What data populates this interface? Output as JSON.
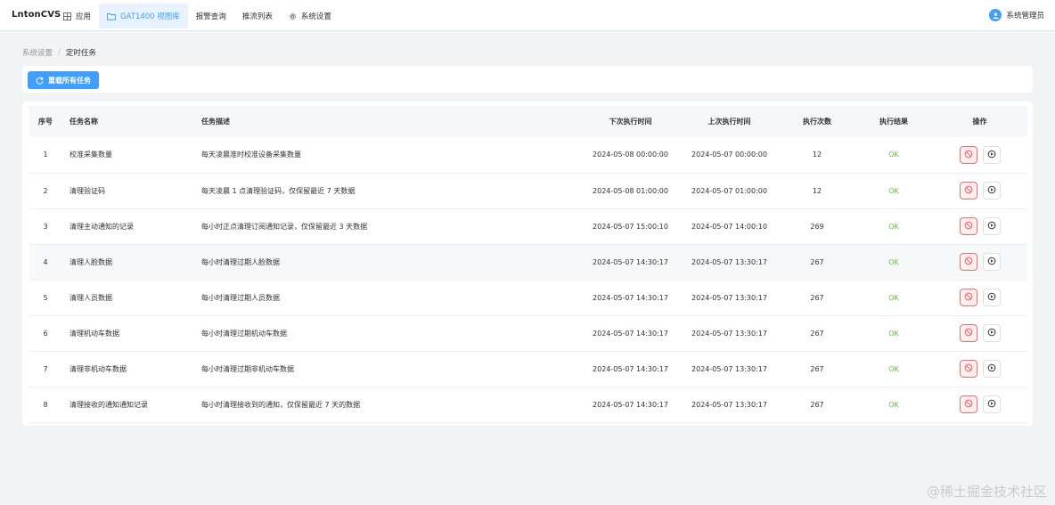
{
  "app": {
    "brand": "LntonCVS"
  },
  "nav": {
    "items": [
      {
        "label": "应用",
        "icon": "grid-icon"
      },
      {
        "label": "GAT1400 视图库",
        "icon": "folder-icon",
        "active": true
      },
      {
        "label": "报警查询"
      },
      {
        "label": "推流列表"
      },
      {
        "label": "系统设置",
        "icon": "gear-icon"
      }
    ]
  },
  "user": {
    "name": "系统管理员",
    "icon": "user-avatar-icon"
  },
  "breadcrumb": {
    "parent": "系统设置",
    "separator": "/",
    "current": "定时任务"
  },
  "toolbar": {
    "reload_label": "重载所有任务",
    "reload_icon": "refresh-icon"
  },
  "table": {
    "headers": {
      "index": "序号",
      "name": "任务名称",
      "description": "任务描述",
      "next_run": "下次执行时间",
      "last_run": "上次执行时间",
      "count": "执行次数",
      "result": "执行结果",
      "actions": "操作"
    },
    "rows": [
      {
        "index": "1",
        "name": "校准采集数量",
        "description": "每天凌晨准时校准设备采集数量",
        "next_run": "2024-05-08 00:00:00",
        "last_run": "2024-05-07 00:00:00",
        "count": "12",
        "result": "OK"
      },
      {
        "index": "2",
        "name": "清理验证码",
        "description": "每天凌晨 1 点清理验证码，仅保留最近 7 天数据",
        "next_run": "2024-05-08 01:00:00",
        "last_run": "2024-05-07 01:00:00",
        "count": "12",
        "result": "OK"
      },
      {
        "index": "3",
        "name": "清理主动通知的记录",
        "description": "每小时正点清理订阅通知记录，仅保留最近 3 天数据",
        "next_run": "2024-05-07 15:00:10",
        "last_run": "2024-05-07 14:00:10",
        "count": "269",
        "result": "OK"
      },
      {
        "index": "4",
        "name": "清理人脸数据",
        "description": "每小时清理过期人脸数据",
        "next_run": "2024-05-07 14:30:17",
        "last_run": "2024-05-07 13:30:17",
        "count": "267",
        "result": "OK"
      },
      {
        "index": "5",
        "name": "清理人员数据",
        "description": "每小时清理过期人员数据",
        "next_run": "2024-05-07 14:30:17",
        "last_run": "2024-05-07 13:30:17",
        "count": "267",
        "result": "OK"
      },
      {
        "index": "6",
        "name": "清理机动车数据",
        "description": "每小时清理过期机动车数据",
        "next_run": "2024-05-07 14:30:17",
        "last_run": "2024-05-07 13:30:17",
        "count": "267",
        "result": "OK"
      },
      {
        "index": "7",
        "name": "清理非机动车数据",
        "description": "每小时清理过期非机动车数据",
        "next_run": "2024-05-07 14:30:17",
        "last_run": "2024-05-07 13:30:17",
        "count": "267",
        "result": "OK"
      },
      {
        "index": "8",
        "name": "清理接收的通知通知记录",
        "description": "每小时清理接收到的通知，仅保留最近 7 天的数据",
        "next_run": "2024-05-07 14:30:17",
        "last_run": "2024-05-07 13:30:17",
        "count": "267",
        "result": "OK"
      }
    ],
    "row_actions": {
      "disable_icon": "ban-icon",
      "run_icon": "play-circle-icon"
    }
  },
  "watermark": "@稀土掘金技术社区",
  "colors": {
    "primary": "#409eff",
    "ok": "#67c23a",
    "danger": "#f56c6c"
  }
}
